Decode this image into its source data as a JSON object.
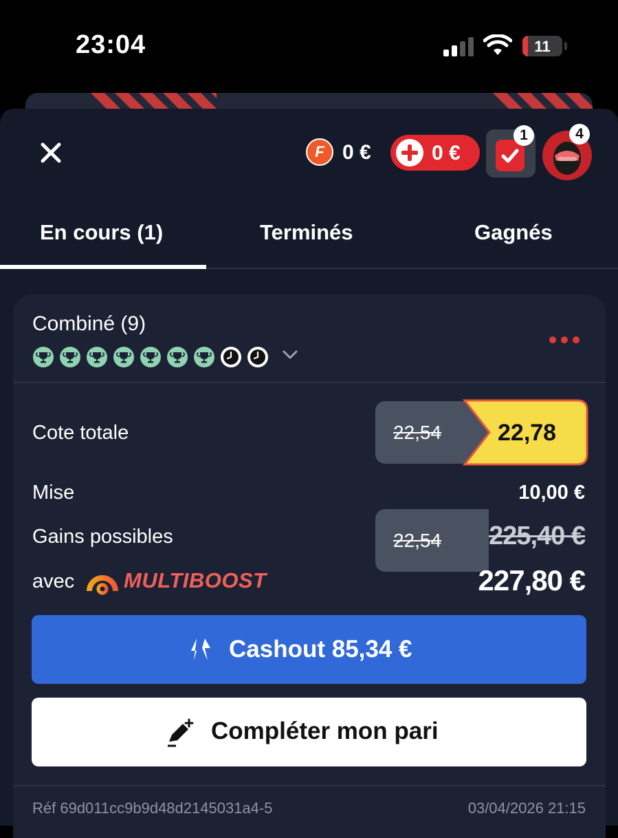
{
  "status_bar": {
    "time": "23:04",
    "battery": "11"
  },
  "header": {
    "freebet_symbol": "F",
    "freebet_amount": "0 €",
    "boost_amount": "0 €",
    "betslip_badge": "1",
    "profile_badge": "4"
  },
  "tabs": [
    {
      "label": "En cours (1)",
      "active": true
    },
    {
      "label": "Terminés",
      "active": false
    },
    {
      "label": "Gagnés",
      "active": false
    }
  ],
  "bet": {
    "type": "Combiné (9)",
    "selections": [
      "won",
      "won",
      "won",
      "won",
      "won",
      "won",
      "won",
      "pending",
      "pending"
    ],
    "cote_label": "Cote totale",
    "cote_old": "22,54",
    "cote_new": "22,78",
    "mise_label": "Mise",
    "mise_value": "10,00 €",
    "gains_label": "Gains possibles",
    "gains_old": "225,40 €",
    "avec_label": "avec",
    "multiboost_label": "MULTIBOOST",
    "gains_new": "227,80 €",
    "cashout_label": "Cashout 85,34 €",
    "complete_label": "Compléter mon pari",
    "ref": "Réf 69d011cc9b9d48d2145031a4-5",
    "date": "03/04/2026 21:15"
  },
  "colors": {
    "accent_red": "#e0282e",
    "cashout_blue": "#3169d8",
    "boost_yellow": "#f7dc4a",
    "won_green": "#8fd3b2"
  },
  "icons": {
    "close": "close-icon",
    "freebet": "freebet-coin-icon",
    "boost": "plus-circle-icon",
    "betslip": "betslip-check-icon",
    "more": "more-dots-icon",
    "chevron": "chevron-down-icon",
    "cashout": "cashout-icon",
    "edit": "pencil-plus-icon"
  }
}
